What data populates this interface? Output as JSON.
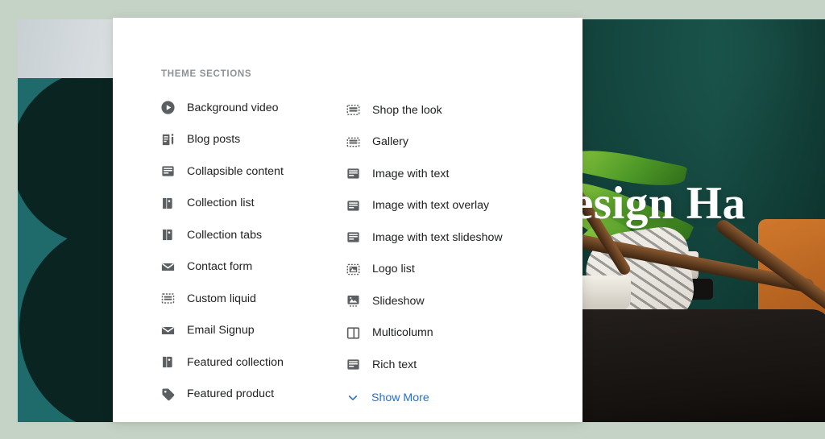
{
  "panel": {
    "title": "THEME SECTIONS",
    "left_column": [
      {
        "label": "Background video",
        "icon": "play-circle-icon"
      },
      {
        "label": "Blog posts",
        "icon": "blog-icon"
      },
      {
        "label": "Collapsible content",
        "icon": "collapsible-content-icon"
      },
      {
        "label": "Collection list",
        "icon": "collection-tag-icon"
      },
      {
        "label": "Collection tabs",
        "icon": "collection-tag-icon"
      },
      {
        "label": "Contact form",
        "icon": "envelope-icon"
      },
      {
        "label": "Custom liquid",
        "icon": "custom-liquid-icon"
      },
      {
        "label": "Email Signup",
        "icon": "envelope-icon"
      },
      {
        "label": "Featured collection",
        "icon": "collection-tag-icon"
      },
      {
        "label": "Featured product",
        "icon": "price-tag-icon"
      }
    ],
    "right_column": [
      {
        "label": "Shop the look",
        "icon": "shop-the-look-icon"
      },
      {
        "label": "Gallery",
        "icon": "gallery-icon"
      },
      {
        "label": "Image with text",
        "icon": "image-with-text-icon"
      },
      {
        "label": "Image with text overlay",
        "icon": "image-with-text-overlay-icon"
      },
      {
        "label": "Image with text slideshow",
        "icon": "image-with-text-slideshow-icon"
      },
      {
        "label": "Logo list",
        "icon": "logo-list-icon"
      },
      {
        "label": "Slideshow",
        "icon": "slideshow-icon"
      },
      {
        "label": "Multicolumn",
        "icon": "multicolumn-icon"
      },
      {
        "label": "Rich text",
        "icon": "rich-text-icon"
      }
    ],
    "show_more": {
      "label": "Show More",
      "icon": "chevron-down-icon"
    }
  },
  "preview": {
    "hero_title": "esign Ha"
  },
  "colors": {
    "page_background": "#c4d3c5",
    "panel_background": "#ffffff",
    "section_heading": "#8c9196",
    "item_label": "#202223",
    "item_icon": "#5c5f62",
    "link_accent": "#2c6ecb",
    "preview_teal": "#1f6b6b",
    "preview_dark_teal": "#0a2421",
    "hero_wall": "#14473f",
    "hero_accent_orange": "#b2601f"
  }
}
